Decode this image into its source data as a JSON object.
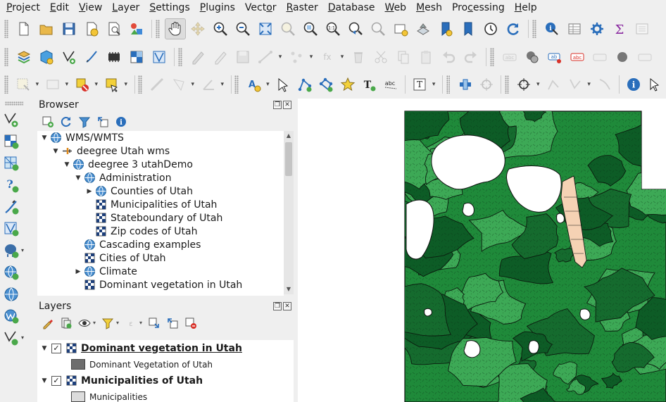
{
  "menubar": {
    "items": [
      {
        "label": "Project",
        "ul": "P",
        "rest": "roject"
      },
      {
        "label": "Edit",
        "ul": "E",
        "rest": "dit"
      },
      {
        "label": "View",
        "ul": "V",
        "rest": "iew"
      },
      {
        "label": "Layer",
        "ul": "L",
        "rest": "ayer"
      },
      {
        "label": "Settings",
        "ul": "S",
        "rest": "ettings"
      },
      {
        "label": "Plugins",
        "ul": "P",
        "rest": "lugins"
      },
      {
        "label": "Vector",
        "ul": "o",
        "pre": "Vect",
        "rest": "r"
      },
      {
        "label": "Raster",
        "ul": "R",
        "rest": "aster"
      },
      {
        "label": "Database",
        "ul": "D",
        "rest": "atabase"
      },
      {
        "label": "Web",
        "ul": "W",
        "rest": "eb"
      },
      {
        "label": "Mesh",
        "ul": "M",
        "rest": "esh"
      },
      {
        "label": "Processing",
        "ul": "c",
        "pre": "Pro",
        "rest": "essing"
      },
      {
        "label": "Help",
        "ul": "H",
        "rest": "elp"
      }
    ]
  },
  "browser": {
    "title": "Browser",
    "tree": [
      {
        "label": "WMS/WMTS",
        "level": 0,
        "arrow": "down",
        "icon": "globe-icon"
      },
      {
        "label": "deegree Utah wms",
        "level": 1,
        "arrow": "down",
        "icon": "connection-icon"
      },
      {
        "label": "deegree 3 utahDemo",
        "level": 2,
        "arrow": "down",
        "icon": "globe-icon"
      },
      {
        "label": "Administration",
        "level": 3,
        "arrow": "down",
        "icon": "globe-icon"
      },
      {
        "label": "Counties of Utah",
        "level": 4,
        "arrow": "right",
        "icon": "globe-icon"
      },
      {
        "label": "Municipalities of Utah",
        "level": 4,
        "arrow": "none",
        "icon": "raster-layer-icon"
      },
      {
        "label": "Stateboundary of Utah",
        "level": 4,
        "arrow": "none",
        "icon": "raster-layer-icon"
      },
      {
        "label": "Zip codes of Utah",
        "level": 4,
        "arrow": "none",
        "icon": "raster-layer-icon"
      },
      {
        "label": "Cascading examples",
        "level": 3,
        "arrow": "none",
        "icon": "globe-icon"
      },
      {
        "label": "Cities of Utah",
        "level": 3,
        "arrow": "none",
        "icon": "raster-layer-icon"
      },
      {
        "label": "Climate",
        "level": 3,
        "arrow": "right",
        "icon": "globe-icon"
      },
      {
        "label": "Dominant vegetation in Utah",
        "level": 3,
        "arrow": "none",
        "icon": "raster-layer-icon"
      }
    ]
  },
  "layers": {
    "title": "Layers",
    "items": [
      {
        "name": "Dominant vegetation in Utah",
        "checked": true,
        "underline": true,
        "legend": "Dominant Vegetation of Utah",
        "legend_color": "#6e6e6e"
      },
      {
        "name": "Municipalities of Utah",
        "checked": true,
        "underline": false,
        "legend": "Municipalities",
        "legend_color": "#dcdcdc"
      }
    ]
  },
  "colors": {
    "veg_dark": "#0d5c26",
    "veg_mid": "#1f8a3a",
    "veg_light": "#3da956",
    "municipal": "#f5d2b4",
    "accent_blue": "#2a6ebb"
  }
}
